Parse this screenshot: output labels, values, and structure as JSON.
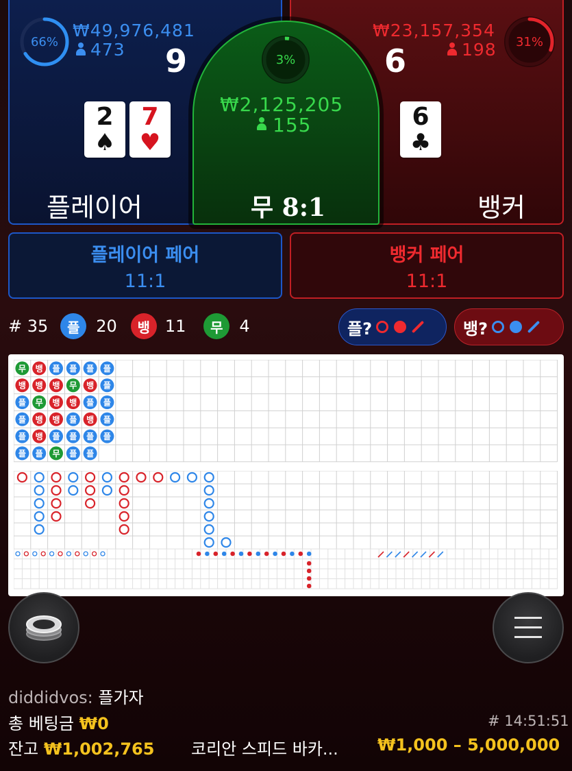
{
  "player": {
    "percent": "66%",
    "amount": "₩49,976,481",
    "users": "473",
    "score": "9",
    "cards": [
      {
        "rank": "2",
        "suit": "♠",
        "color": "black"
      },
      {
        "rank": "7",
        "suit": "♥",
        "color": "red"
      }
    ],
    "title": "플레이어",
    "color": "#3b8ef0"
  },
  "tie": {
    "percent": "3%",
    "amount": "₩2,125,205",
    "users": "155",
    "title": "무 8:1",
    "color": "#38d94c"
  },
  "banker": {
    "percent": "31%",
    "amount": "₩23,157,354",
    "users": "198",
    "score": "6",
    "cards": [
      {
        "rank": "6",
        "suit": "♣",
        "color": "black"
      }
    ],
    "title": "뱅커",
    "color": "#ef2a2f"
  },
  "pairs": {
    "player_title": "플레이어 페어",
    "player_odds": "11:1",
    "banker_title": "뱅커 페어",
    "banker_odds": "11:1"
  },
  "stats": {
    "round": "# 35",
    "player_label": "플",
    "player_count": "20",
    "banker_label": "뱅",
    "banker_count": "11",
    "tie_label": "무",
    "tie_count": "4"
  },
  "predict": {
    "player_label": "플?",
    "banker_label": "뱅?"
  },
  "bead_road": [
    [
      "무",
      "뱅",
      "플",
      "플",
      "플",
      "플"
    ],
    [
      "뱅",
      "뱅",
      "뱅",
      "무",
      "뱅",
      "플"
    ],
    [
      "플",
      "무",
      "뱅",
      "뱅",
      "플",
      "플"
    ],
    [
      "플",
      "뱅",
      "뱅",
      "플",
      "뱅",
      "플"
    ],
    [
      "플",
      "뱅",
      "플",
      "플",
      "플",
      "플"
    ],
    [
      "플",
      "플",
      "무",
      "플",
      "플"
    ]
  ],
  "footer": {
    "user": "diddidvos:",
    "user_bet": "플가자",
    "total_bet_label": "총 베팅금",
    "total_bet": "₩0",
    "time": "# 14:51:51",
    "balance_label": "잔고",
    "balance": "₩1,002,765",
    "game_name": "코리안 스피드 바카...",
    "limits": "₩1,000 – 5,000,000"
  },
  "icons": {
    "chip_stack": "chip-stack-icon",
    "menu": "menu-icon"
  }
}
